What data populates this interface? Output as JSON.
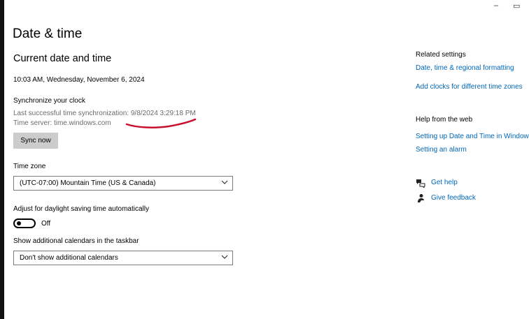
{
  "window": {
    "minimize_glyph": "–",
    "maximize_glyph": "▭"
  },
  "page": {
    "title": "Date & time",
    "section_title": "Current date and time",
    "current_datetime": "10:03 AM, Wednesday, November 6, 2024"
  },
  "sync": {
    "heading": "Synchronize your clock",
    "last_sync": "Last successful time synchronization: 9/8/2024 3:29:18 PM",
    "time_server": "Time server: time.windows.com",
    "button_label": "Sync now",
    "annotation_color": "#c8102e"
  },
  "timezone": {
    "label": "Time zone",
    "selected": "(UTC-07:00) Mountain Time (US & Canada)"
  },
  "dst": {
    "label": "Adjust for daylight saving time automatically",
    "state": "Off"
  },
  "calendars": {
    "label": "Show additional calendars in the taskbar",
    "selected": "Don't show additional calendars"
  },
  "related": {
    "heading": "Related settings",
    "links": [
      "Date, time & regional formatting",
      "Add clocks for different time zones"
    ]
  },
  "help_web": {
    "heading": "Help from the web",
    "links": [
      "Setting up Date and Time in Windows",
      "Setting an alarm"
    ]
  },
  "support": {
    "get_help": "Get help",
    "give_feedback": "Give feedback"
  },
  "colors": {
    "link": "#0067b8",
    "secondary_text": "#6b6b6b",
    "button_bg": "#cccccc"
  },
  "icons": [
    "minimize-icon",
    "maximize-icon",
    "chevron-down-icon",
    "get-help-icon",
    "feedback-icon"
  ]
}
